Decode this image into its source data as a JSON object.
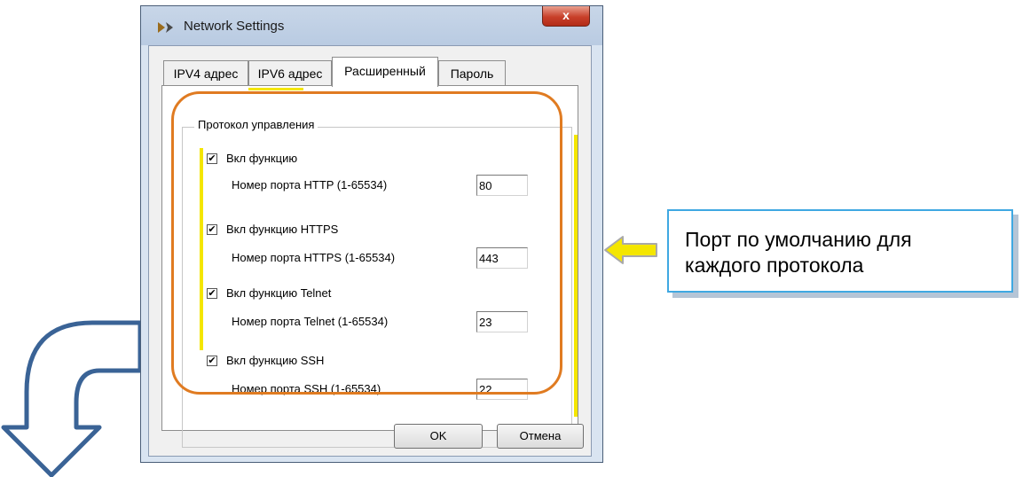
{
  "window": {
    "title": "Network Settings",
    "close_glyph": "x"
  },
  "tabs": [
    {
      "label": "IPV4 адрес"
    },
    {
      "label": "IPV6 адрес"
    },
    {
      "label": "Расширенный"
    },
    {
      "label": "Пароль"
    }
  ],
  "active_tab": "Расширенный",
  "group": {
    "title": "Протокол управления"
  },
  "protocols": [
    {
      "checkbox_label": "Вкл функцию",
      "checked": true,
      "port_label": "Номер порта HTTP (1-65534)",
      "port_value": "80"
    },
    {
      "checkbox_label": "Вкл функцию HTTPS",
      "checked": true,
      "port_label": "Номер порта HTTPS (1-65534)",
      "port_value": "443"
    },
    {
      "checkbox_label": "Вкл функцию Telnet",
      "checked": true,
      "port_label": "Номер порта Telnet (1-65534)",
      "port_value": "23"
    },
    {
      "checkbox_label": "Вкл функцию SSH",
      "checked": true,
      "port_label": "Номер порта SSH (1-65534)",
      "port_value": "22"
    }
  ],
  "buttons": {
    "ok": "OK",
    "cancel": "Отмена"
  },
  "callout": {
    "line1": "Порт по умолчанию для",
    "line2": "каждого протокола"
  },
  "colors": {
    "highlight_ring": "#e07b21",
    "marker_yellow": "#f4e600",
    "callout_border": "#3fa8e2",
    "big_arrow": "#3a6396",
    "close_button": "#c8402a"
  },
  "icons": {
    "app": "app-chevron-icon",
    "close": "close-icon",
    "pointer_arrow": "yellow-arrow-icon",
    "curved_arrow": "curved-down-arrow-icon",
    "checkbox": "checkmark-icon"
  }
}
